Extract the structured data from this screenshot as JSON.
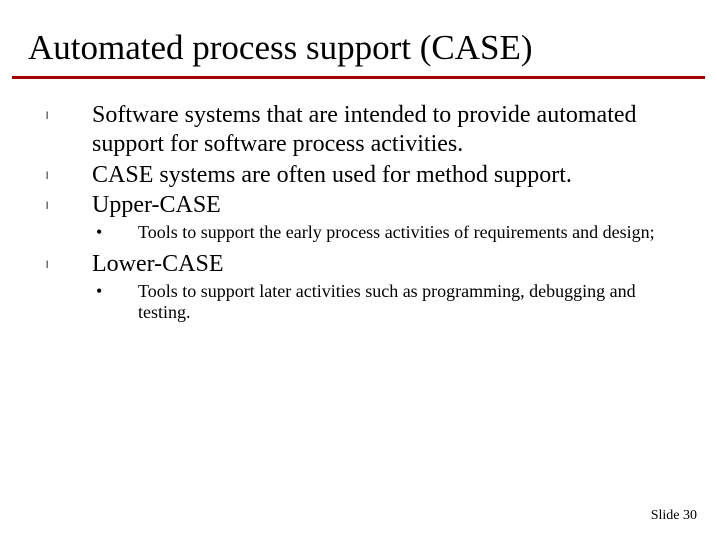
{
  "title": "Automated process support (CASE)",
  "bullets": [
    {
      "marker": "l",
      "text": "Software systems that are intended to provide automated support for software process activities."
    },
    {
      "marker": "l",
      "text": "CASE systems are often used for method support."
    },
    {
      "marker": "l",
      "text": "Upper-CASE",
      "sub": [
        {
          "marker": "•",
          "text": "Tools to support the early process activities of requirements and design;"
        }
      ]
    },
    {
      "marker": "l",
      "text": "Lower-CASE",
      "sub": [
        {
          "marker": "•",
          "text": "Tools to support later activities such as programming, debugging and testing."
        }
      ]
    }
  ],
  "footer": "Slide  30"
}
